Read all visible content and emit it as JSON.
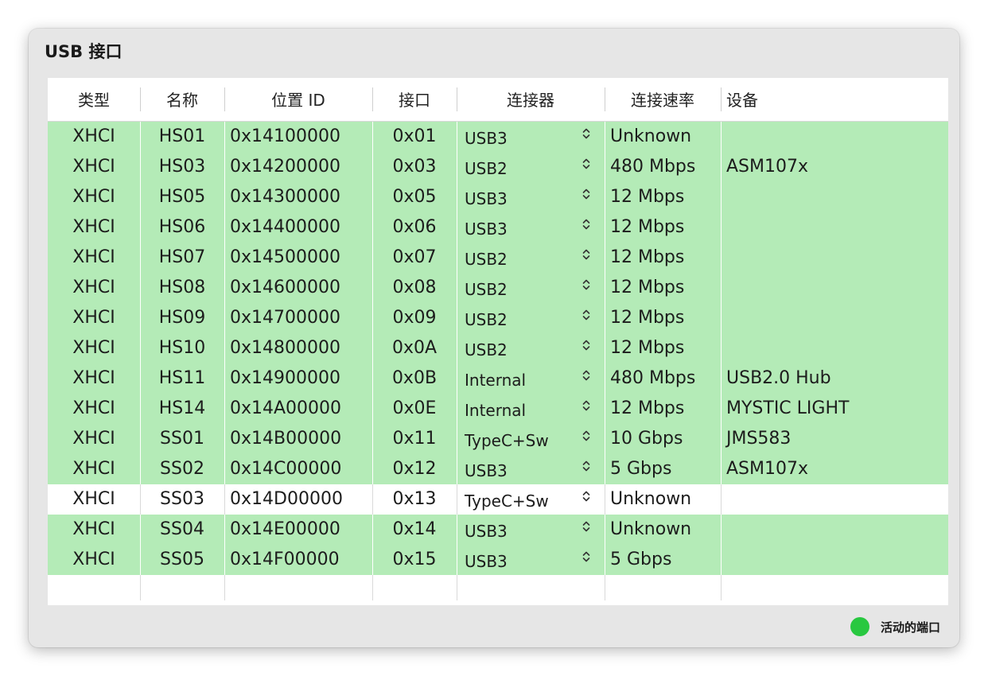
{
  "panel": {
    "title": "USB 接口"
  },
  "columns": {
    "type": "类型",
    "name": "名称",
    "location": "位置 ID",
    "port": "接口",
    "connector": "连接器",
    "speed": "连接速率",
    "device": "设备"
  },
  "rows": [
    {
      "type": "XHCI",
      "name": "HS01",
      "location": "0x14100000",
      "port": "0x01",
      "connector": "USB3",
      "speed": "Unknown",
      "device": "",
      "active": true
    },
    {
      "type": "XHCI",
      "name": "HS03",
      "location": "0x14200000",
      "port": "0x03",
      "connector": "USB2",
      "speed": "480 Mbps",
      "device": "ASM107x",
      "active": true
    },
    {
      "type": "XHCI",
      "name": "HS05",
      "location": "0x14300000",
      "port": "0x05",
      "connector": "USB3",
      "speed": "12 Mbps",
      "device": "",
      "active": true
    },
    {
      "type": "XHCI",
      "name": "HS06",
      "location": "0x14400000",
      "port": "0x06",
      "connector": "USB3",
      "speed": "12 Mbps",
      "device": "",
      "active": true
    },
    {
      "type": "XHCI",
      "name": "HS07",
      "location": "0x14500000",
      "port": "0x07",
      "connector": "USB2",
      "speed": "12 Mbps",
      "device": "",
      "active": true
    },
    {
      "type": "XHCI",
      "name": "HS08",
      "location": "0x14600000",
      "port": "0x08",
      "connector": "USB2",
      "speed": "12 Mbps",
      "device": "",
      "active": true
    },
    {
      "type": "XHCI",
      "name": "HS09",
      "location": "0x14700000",
      "port": "0x09",
      "connector": "USB2",
      "speed": "12 Mbps",
      "device": "",
      "active": true
    },
    {
      "type": "XHCI",
      "name": "HS10",
      "location": "0x14800000",
      "port": "0x0A",
      "connector": "USB2",
      "speed": "12 Mbps",
      "device": "",
      "active": true
    },
    {
      "type": "XHCI",
      "name": "HS11",
      "location": "0x14900000",
      "port": "0x0B",
      "connector": "Internal",
      "speed": "480 Mbps",
      "device": "USB2.0 Hub",
      "active": true
    },
    {
      "type": "XHCI",
      "name": "HS14",
      "location": "0x14A00000",
      "port": "0x0E",
      "connector": "Internal",
      "speed": "12 Mbps",
      "device": "MYSTIC LIGHT",
      "active": true
    },
    {
      "type": "XHCI",
      "name": "SS01",
      "location": "0x14B00000",
      "port": "0x11",
      "connector": "TypeC+Sw",
      "speed": "10 Gbps",
      "device": "JMS583",
      "active": true
    },
    {
      "type": "XHCI",
      "name": "SS02",
      "location": "0x14C00000",
      "port": "0x12",
      "connector": "USB3",
      "speed": "5 Gbps",
      "device": "ASM107x",
      "active": true
    },
    {
      "type": "XHCI",
      "name": "SS03",
      "location": "0x14D00000",
      "port": "0x13",
      "connector": "TypeC+Sw",
      "speed": "Unknown",
      "device": "",
      "active": false
    },
    {
      "type": "XHCI",
      "name": "SS04",
      "location": "0x14E00000",
      "port": "0x14",
      "connector": "USB3",
      "speed": "Unknown",
      "device": "",
      "active": true
    },
    {
      "type": "XHCI",
      "name": "SS05",
      "location": "0x14F00000",
      "port": "0x15",
      "connector": "USB3",
      "speed": "5 Gbps",
      "device": "",
      "active": true
    }
  ],
  "legend": {
    "label": "活动的端口",
    "color": "#28c840"
  },
  "colors": {
    "active_row": "#b4ebb7",
    "inactive_row": "#ffffff"
  },
  "icons": {
    "stepper": "chevron-up-down-icon"
  }
}
